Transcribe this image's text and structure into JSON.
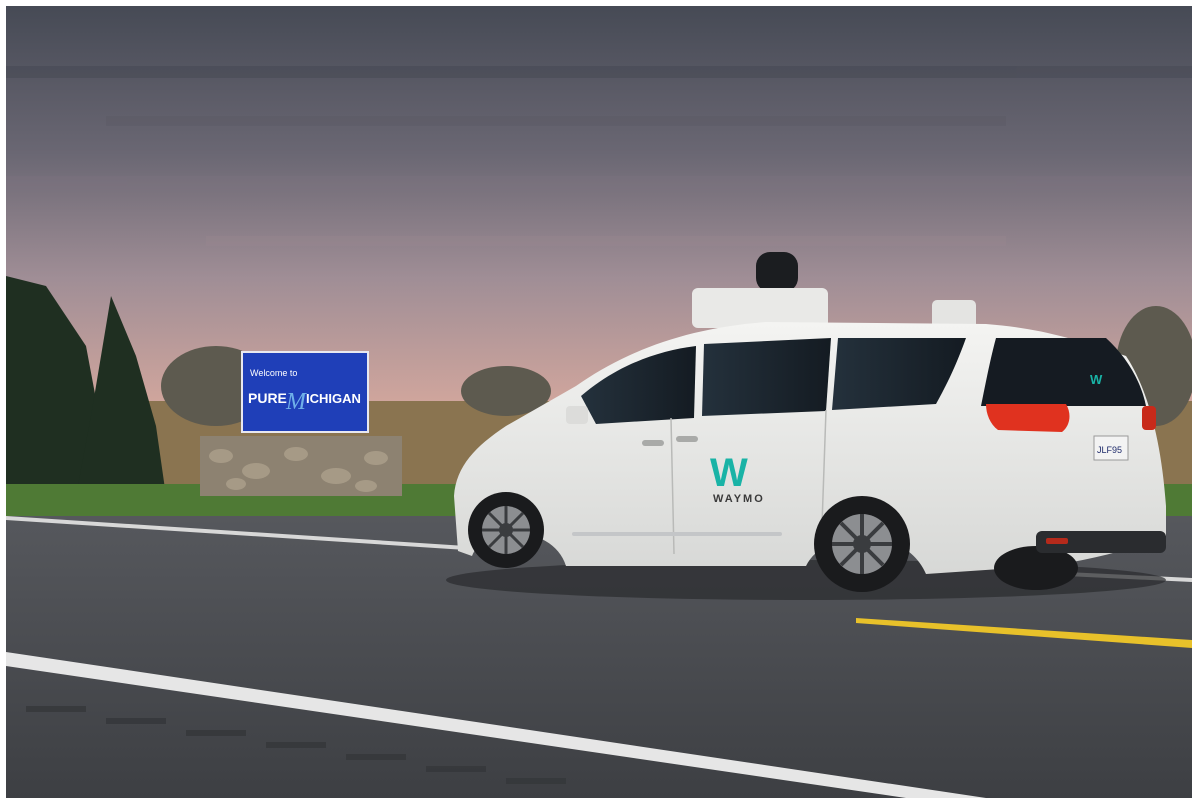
{
  "image": {
    "kind": "photograph",
    "colors": {
      "sky_top": "#4b4f59",
      "sky_mid": "#8a7d86",
      "sky_horizon": "#d8a79a",
      "grass": "#4f7a35",
      "road": "#4a4c50",
      "sign_blue": "#1f3fb8",
      "vehicle_body": "#eeeeec",
      "window_tint": "#1b2630",
      "brand_teal": "#19b3a6",
      "brand_green": "#35c36a",
      "taillight": "#e0321f",
      "center_line": "#e8c12a"
    }
  },
  "sign": {
    "welcome_text": "Welcome to",
    "pure_text": "PURE",
    "michigan_text": "ICHIGAN",
    "m_letter": "M"
  },
  "vehicle": {
    "logo_mark": "W",
    "brand_name": "WAYMO",
    "rear_logo_mark": "W",
    "plate_text": "JLF95"
  }
}
